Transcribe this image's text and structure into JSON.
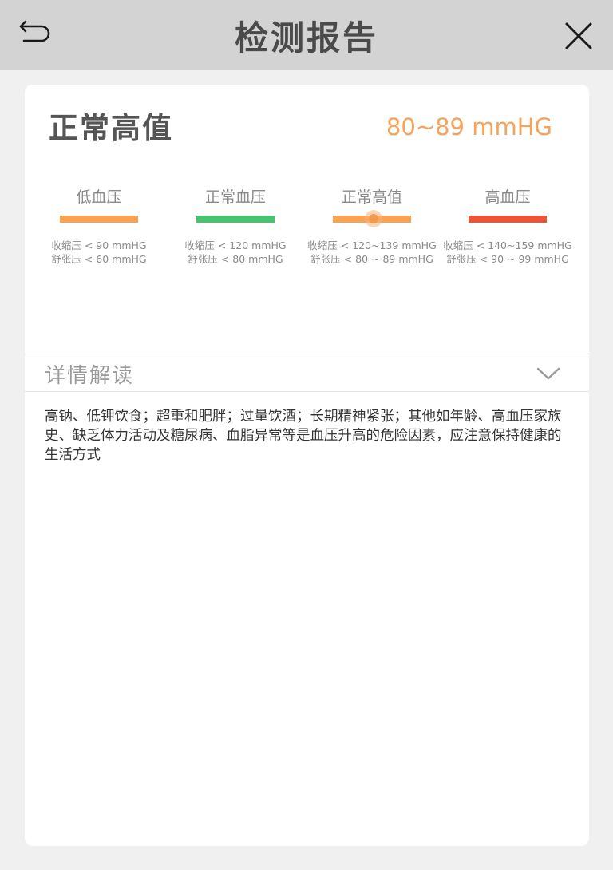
{
  "header": {
    "title": "检测报告",
    "back_icon": "back-arrow-icon",
    "close_icon": "close-icon"
  },
  "result": {
    "label": "正常高值",
    "value": "80~89 mmHG",
    "value_color": "#f5a35a"
  },
  "levels": [
    {
      "name": "低血压",
      "color": "#f9a352",
      "systolic": "收缩压 < 90 mmHG",
      "diastolic": "舒张压 < 60 mmHG"
    },
    {
      "name": "正常血压",
      "color": "#46c46d",
      "systolic": "收缩压 < 120 mmHG",
      "diastolic": "舒张压 <  80  mmHG"
    },
    {
      "name": "正常高值",
      "color": "#f9a352",
      "systolic": "收缩压 < 120~139 mmHG",
      "diastolic": "舒张压 <  80 ~ 89  mmHG",
      "current": true
    },
    {
      "name": "高血压",
      "color": "#ee5335",
      "systolic": "收缩压 < 140~159 mmHG",
      "diastolic": "舒张压 <  90 ~ 99  mmHG"
    }
  ],
  "details": {
    "title": "详情解读",
    "toggle_icon": "chevron-down-icon",
    "text": "高钠、低钾饮食；超重和肥胖；过量饮酒；长期精神紧张；其他如年龄、高血压家族史、缺乏体力活动及糖尿病、血脂异常等是血压升高的危险因素，应注意保持健康的生活方式"
  }
}
